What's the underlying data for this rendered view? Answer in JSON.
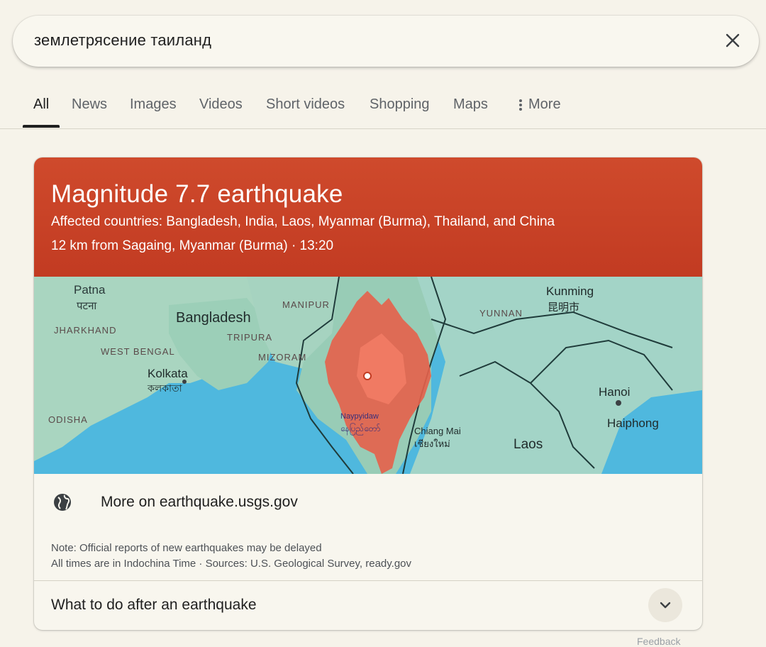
{
  "search": {
    "query": "землетрясение таиланд"
  },
  "tabs": [
    {
      "label": "All",
      "active": true
    },
    {
      "label": "News"
    },
    {
      "label": "Images"
    },
    {
      "label": "Videos"
    },
    {
      "label": "Short videos"
    },
    {
      "label": "Shopping"
    },
    {
      "label": "Maps"
    },
    {
      "label": "More",
      "icon": "vertical-dots-icon"
    }
  ],
  "alert": {
    "title": "Magnitude 7.7 earthquake",
    "countries": "Affected countries: Bangladesh, India, Laos, Myanmar (Burma), Thailand, and China",
    "location": "12 km from Sagaing, Myanmar (Burma) · 13:20",
    "color": "#c8432a"
  },
  "map": {
    "labels": {
      "patna": "Patna",
      "patna_local": "पटना",
      "jharkhand": "JHARKHAND",
      "west_bengal": "WEST BENGAL",
      "bangladesh": "Bangladesh",
      "kolkata": "Kolkata",
      "kolkata_local": "কলকাতা",
      "odisha": "ODISHA",
      "manipur": "MANIPUR",
      "tripura": "TRIPURA",
      "mizoram": "MIZORAM",
      "naypyidaw": "Naypyidaw",
      "naypyidaw_local": "နေပြည်တော်",
      "chiang_mai": "Chiang Mai",
      "chiang_mai_local": "เชียงใหม่",
      "kunming": "Kunming",
      "kunming_local": "昆明市",
      "yunnan": "YUNNAN",
      "laos": "Laos",
      "hanoi": "Hanoi",
      "haiphong": "Haiphong"
    },
    "colors": {
      "water": "#4fb8de",
      "land": "#9fd0c2",
      "shake": "#e6604a"
    }
  },
  "source": {
    "more_on": "More on earthquake.usgs.gov",
    "icon": "globe-icon"
  },
  "notes": {
    "line1": "Note: Official reports of new earthquakes may be delayed",
    "line2": "All times are in Indochina Time · Sources: U.S. Geological Survey, ready.gov"
  },
  "after": {
    "label": "What to do after an earthquake",
    "icon": "chevron-down-icon"
  },
  "feedback": "Feedback"
}
